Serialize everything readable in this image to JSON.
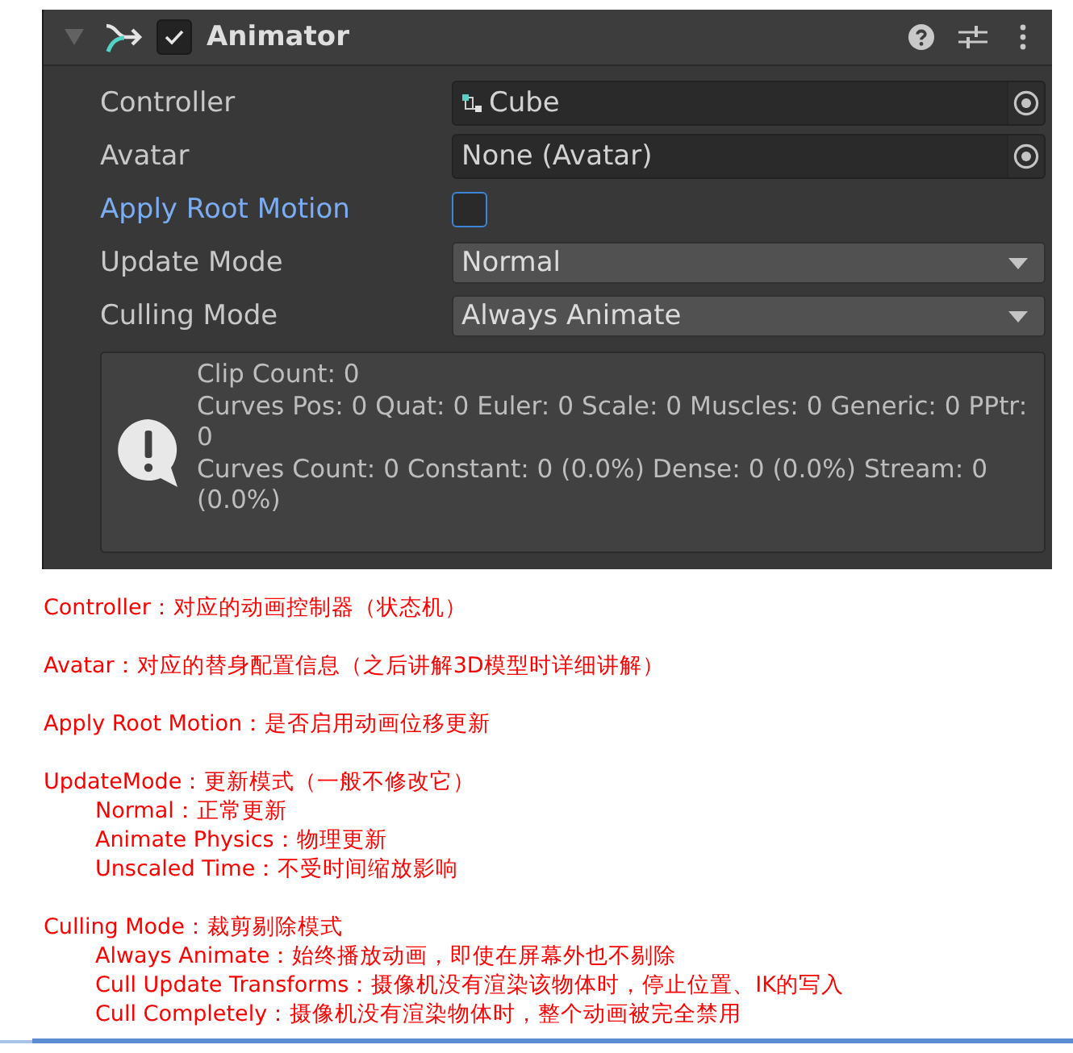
{
  "inspector": {
    "component": {
      "title": "Animator",
      "enabled": true,
      "expanded": true
    },
    "properties": [
      {
        "kind": "object",
        "label": "Controller",
        "value": "Cube",
        "has_icon": true,
        "focused": false
      },
      {
        "kind": "object",
        "label": "Avatar",
        "value": "None (Avatar)",
        "has_icon": false,
        "focused": false
      },
      {
        "kind": "toggle",
        "label": "Apply Root Motion",
        "checked": false,
        "focused": true
      },
      {
        "kind": "dropdown",
        "label": "Update Mode",
        "value": "Normal",
        "focused": false
      },
      {
        "kind": "dropdown",
        "label": "Culling Mode",
        "value": "Always Animate",
        "focused": false
      }
    ],
    "info_box": {
      "lines": [
        "Clip Count: 0",
        "Curves Pos: 0 Quat: 0 Euler: 0 Scale: 0 Muscles: 0 Generic: 0 PPtr: 0",
        "Curves Count: 0 Constant: 0 (0.0%) Dense: 0 (0.0%) Stream: 0 (0.0%)"
      ]
    }
  },
  "notes": [
    {
      "text": "Controller：对应的动画控制器（状态机）"
    },
    {
      "text": "Avatar：对应的替身配置信息（之后讲解3D模型时详细讲解）"
    },
    {
      "text": "Apply Root Motion：是否启用动画位移更新"
    },
    {
      "text": "UpdateMode：更新模式（一般不修改它）",
      "children": [
        {
          "text": "Normal：正常更新"
        },
        {
          "text": "Animate Physics：物理更新"
        },
        {
          "text": "Unscaled Time：不受时间缩放影响"
        }
      ]
    },
    {
      "text": "Culling Mode：裁剪剔除模式",
      "children": [
        {
          "text": "Always Animate：始终播放动画，即使在屏幕外也不剔除"
        },
        {
          "text": "Cull Update Transforms：摄像机没有渲染该物体时，停止位置、IK的写入"
        },
        {
          "text": "Cull Completely：摄像机没有渲染物体时，整个动画被完全禁用"
        }
      ]
    }
  ]
}
